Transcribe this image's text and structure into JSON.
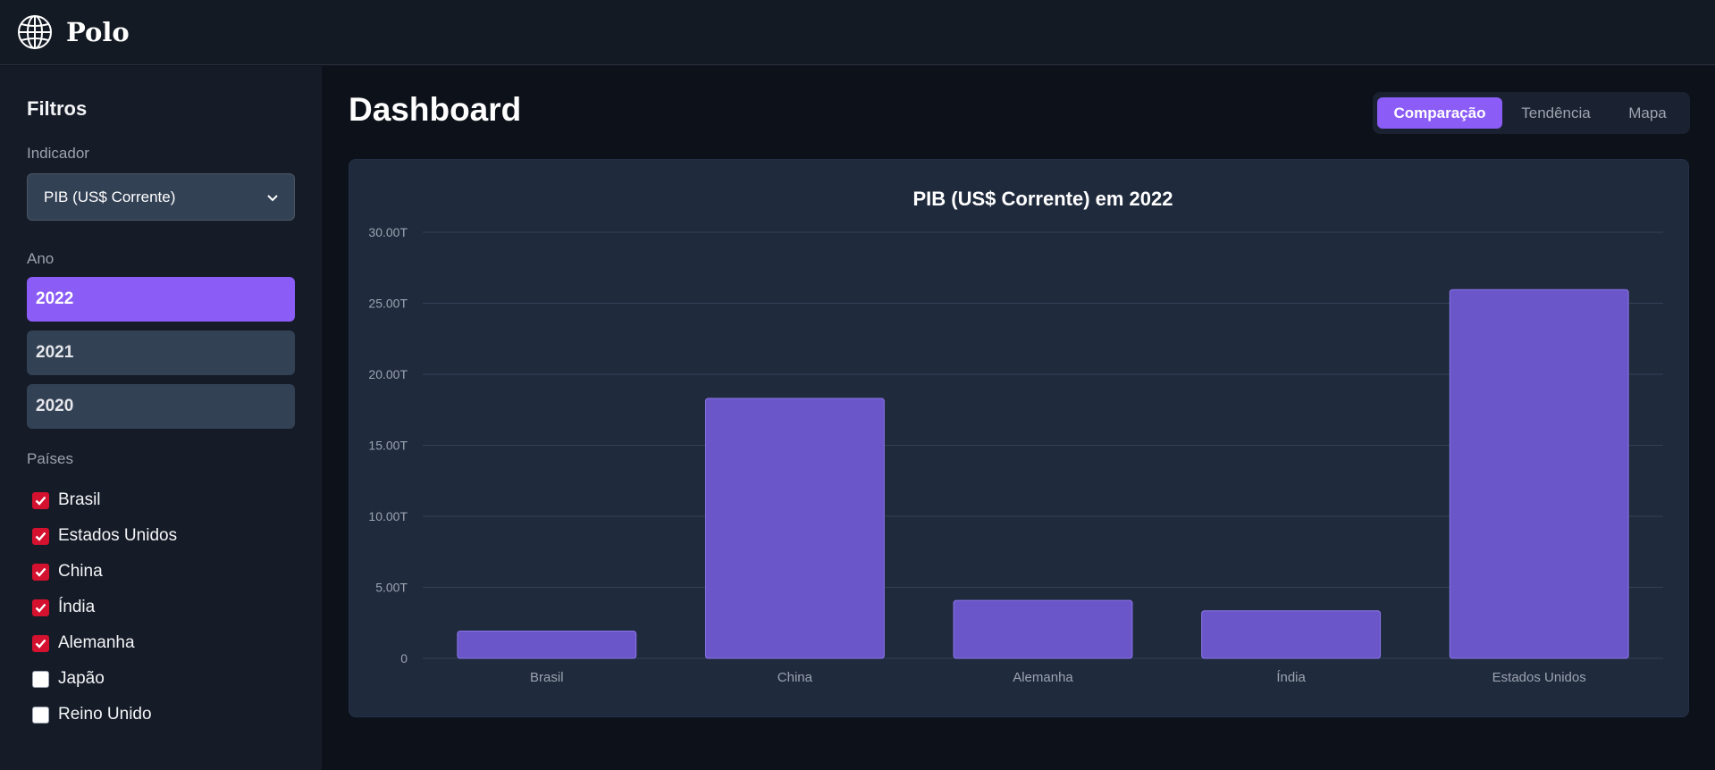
{
  "app": {
    "name": "Polo",
    "logo_icon": "globe-icon"
  },
  "sidebar": {
    "title": "Filtros",
    "indicator": {
      "label": "Indicador",
      "selected": "PIB (US$ Corrente)"
    },
    "year": {
      "label": "Ano",
      "options": [
        "2022",
        "2021",
        "2020"
      ],
      "selected": "2022"
    },
    "countries": {
      "label": "Países",
      "items": [
        {
          "name": "Brasil",
          "checked": true
        },
        {
          "name": "Estados Unidos",
          "checked": true
        },
        {
          "name": "China",
          "checked": true
        },
        {
          "name": "Índia",
          "checked": true
        },
        {
          "name": "Alemanha",
          "checked": true
        },
        {
          "name": "Japão",
          "checked": false
        },
        {
          "name": "Reino Unido",
          "checked": false
        }
      ]
    }
  },
  "main": {
    "title": "Dashboard",
    "tabs": [
      {
        "label": "Comparação",
        "active": true
      },
      {
        "label": "Tendência",
        "active": false
      },
      {
        "label": "Mapa",
        "active": false
      }
    ]
  },
  "colors": {
    "accent": "#8b5cf6",
    "bar": "#6a55c9",
    "checkbox": "#d4112e"
  },
  "chart_data": {
    "type": "bar",
    "title": "PIB (US$ Corrente) em 2022",
    "categories": [
      "Brasil",
      "China",
      "Alemanha",
      "Índia",
      "Estados Unidos"
    ],
    "values": [
      1.92,
      18.3,
      4.08,
      3.35,
      25.96
    ],
    "unit": "T",
    "ylim": [
      0,
      30
    ],
    "yticks": [
      "0",
      "5.00T",
      "10.00T",
      "15.00T",
      "20.00T",
      "25.00T",
      "30.00T"
    ],
    "grid": true
  }
}
